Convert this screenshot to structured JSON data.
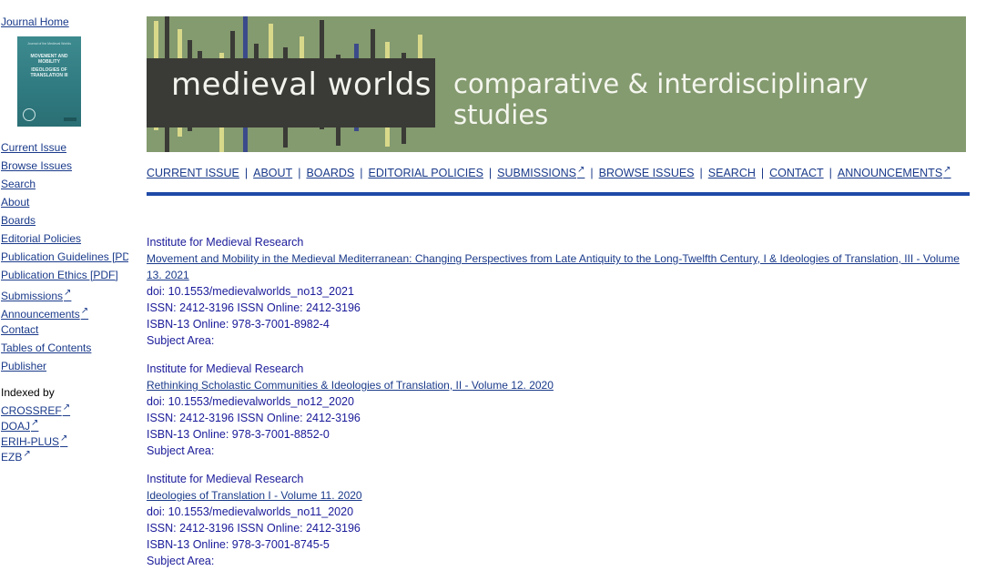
{
  "sidebar": {
    "journal_home": "Journal Home",
    "cover": {
      "small_text": "Journal of the Medieval Worlds",
      "title_a": "MOVEMENT AND MOBILITY",
      "title_b": "IDEOLOGIES OF TRANSLATION III"
    },
    "links": [
      {
        "label": "Current Issue",
        "external": false
      },
      {
        "label": "Browse Issues",
        "external": false
      },
      {
        "label": "Search",
        "external": false
      },
      {
        "label": "About",
        "external": false
      },
      {
        "label": "Boards",
        "external": false
      },
      {
        "label": "Editorial Policies",
        "external": false
      },
      {
        "label": "Publication Guidelines [PDF]",
        "external": false
      },
      {
        "label": "Publication Ethics [PDF]",
        "external": false
      },
      {
        "label": "Submissions",
        "external": true
      },
      {
        "label": "Announcements",
        "external": true
      },
      {
        "label": "Contact",
        "external": false
      },
      {
        "label": "Tables of Contents",
        "external": false
      },
      {
        "label": "Publisher",
        "external": false
      }
    ],
    "indexed_label": "Indexed by",
    "indexed": [
      {
        "label": "CROSSREF",
        "external": true
      },
      {
        "label": "DOAJ",
        "external": true
      },
      {
        "label": "ERIH-PLUS",
        "external": true
      },
      {
        "label": "EZB",
        "external": true
      }
    ]
  },
  "banner": {
    "title": "medieval worlds",
    "subtitle": "comparative & interdisciplinary studies",
    "colors": {
      "background": "#849a6f",
      "box": "#3a3a36",
      "bar_dark": "#3a3a36",
      "bar_light": "#d9d98a",
      "bar_blue": "#3b4a8a"
    }
  },
  "topnav": {
    "items": [
      {
        "label": "CURRENT ISSUE",
        "external": false
      },
      {
        "label": "ABOUT",
        "external": false
      },
      {
        "label": "BOARDS",
        "external": false
      },
      {
        "label": "EDITORIAL POLICIES",
        "external": false
      },
      {
        "label": "SUBMISSIONS",
        "external": true
      },
      {
        "label": "BROWSE ISSUES",
        "external": false
      },
      {
        "label": "SEARCH",
        "external": false
      },
      {
        "label": "CONTACT",
        "external": false
      },
      {
        "label": "ANNOUNCEMENTS",
        "external": true
      }
    ],
    "separator": "|",
    "rule_color": "#1f4aa8"
  },
  "issues": [
    {
      "publisher": "Institute for Medieval Research",
      "title": "Movement and Mobility in the Medieval Mediterranean: Changing Perspectives from Late Antiquity to the Long-Twelfth Century, I & Ideologies of Translation, III - Volume 13. 2021",
      "doi": "doi: 10.1553/medievalworlds_no13_2021",
      "issn": "ISSN: 2412-3196 ISSN Online: 2412-3196",
      "isbn": "ISBN-13 Online: 978-3-7001-8982-4",
      "subject": "Subject Area:"
    },
    {
      "publisher": "Institute for Medieval Research",
      "title": "Rethinking Scholastic Communities & Ideologies of Translation, II - Volume 12. 2020",
      "doi": "doi: 10.1553/medievalworlds_no12_2020",
      "issn": "ISSN: 2412-3196 ISSN Online: 2412-3196",
      "isbn": "ISBN-13 Online: 978-3-7001-8852-0",
      "subject": "Subject Area:"
    },
    {
      "publisher": "Institute for Medieval Research",
      "title": "Ideologies of Translation I - Volume 11. 2020",
      "doi": "doi: 10.1553/medievalworlds_no11_2020",
      "issn": "ISSN: 2412-3196 ISSN Online: 2412-3196",
      "isbn": "ISBN-13 Online: 978-3-7001-8745-5",
      "subject": "Subject Area:"
    }
  ]
}
